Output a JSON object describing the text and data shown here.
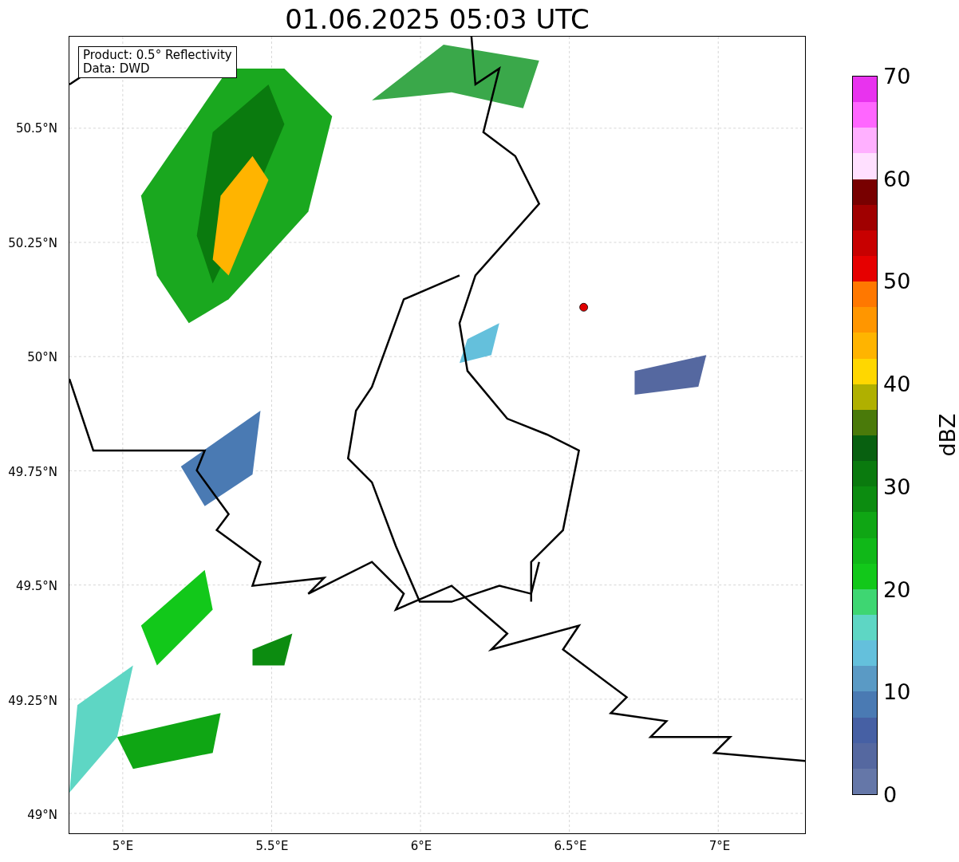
{
  "title": "01.06.2025 05:03 UTC",
  "map": {
    "info_lines": [
      "Product: 0.5° Reflectivity",
      "Data: DWD"
    ],
    "lat_ticks": [
      "50.5°N",
      "50.25°N",
      "50°N",
      "49.75°N",
      "49.5°N",
      "49.25°N",
      "49°N"
    ],
    "lon_ticks": [
      "5°E",
      "5.5°E",
      "6°E",
      "6.5°E",
      "7°E"
    ]
  },
  "colorbar": {
    "label": "dBZ",
    "ticks": [
      "70",
      "60",
      "50",
      "40",
      "30",
      "20",
      "10",
      "0"
    ],
    "segments": [
      {
        "color": "#e833ee"
      },
      {
        "color": "#ff66ff"
      },
      {
        "color": "#ffb0ff"
      },
      {
        "color": "#ffe0ff"
      },
      {
        "color": "#780000"
      },
      {
        "color": "#a00000"
      },
      {
        "color": "#c80000"
      },
      {
        "color": "#e60000"
      },
      {
        "color": "#ff7800"
      },
      {
        "color": "#ff9600"
      },
      {
        "color": "#ffb400"
      },
      {
        "color": "#ffd700"
      },
      {
        "color": "#b0b000"
      },
      {
        "color": "#4a7a0a"
      },
      {
        "color": "#086010"
      },
      {
        "color": "#0a7a0e"
      },
      {
        "color": "#0c8c10"
      },
      {
        "color": "#0fa614"
      },
      {
        "color": "#10b818"
      },
      {
        "color": "#12c81a"
      },
      {
        "color": "#3ed672"
      },
      {
        "color": "#5ed6c4"
      },
      {
        "color": "#64c0dc"
      },
      {
        "color": "#5a9ac5"
      },
      {
        "color": "#4a7ab3"
      },
      {
        "color": "#4660a4"
      },
      {
        "color": "#5568a0"
      },
      {
        "color": "#6577a8"
      }
    ]
  }
}
